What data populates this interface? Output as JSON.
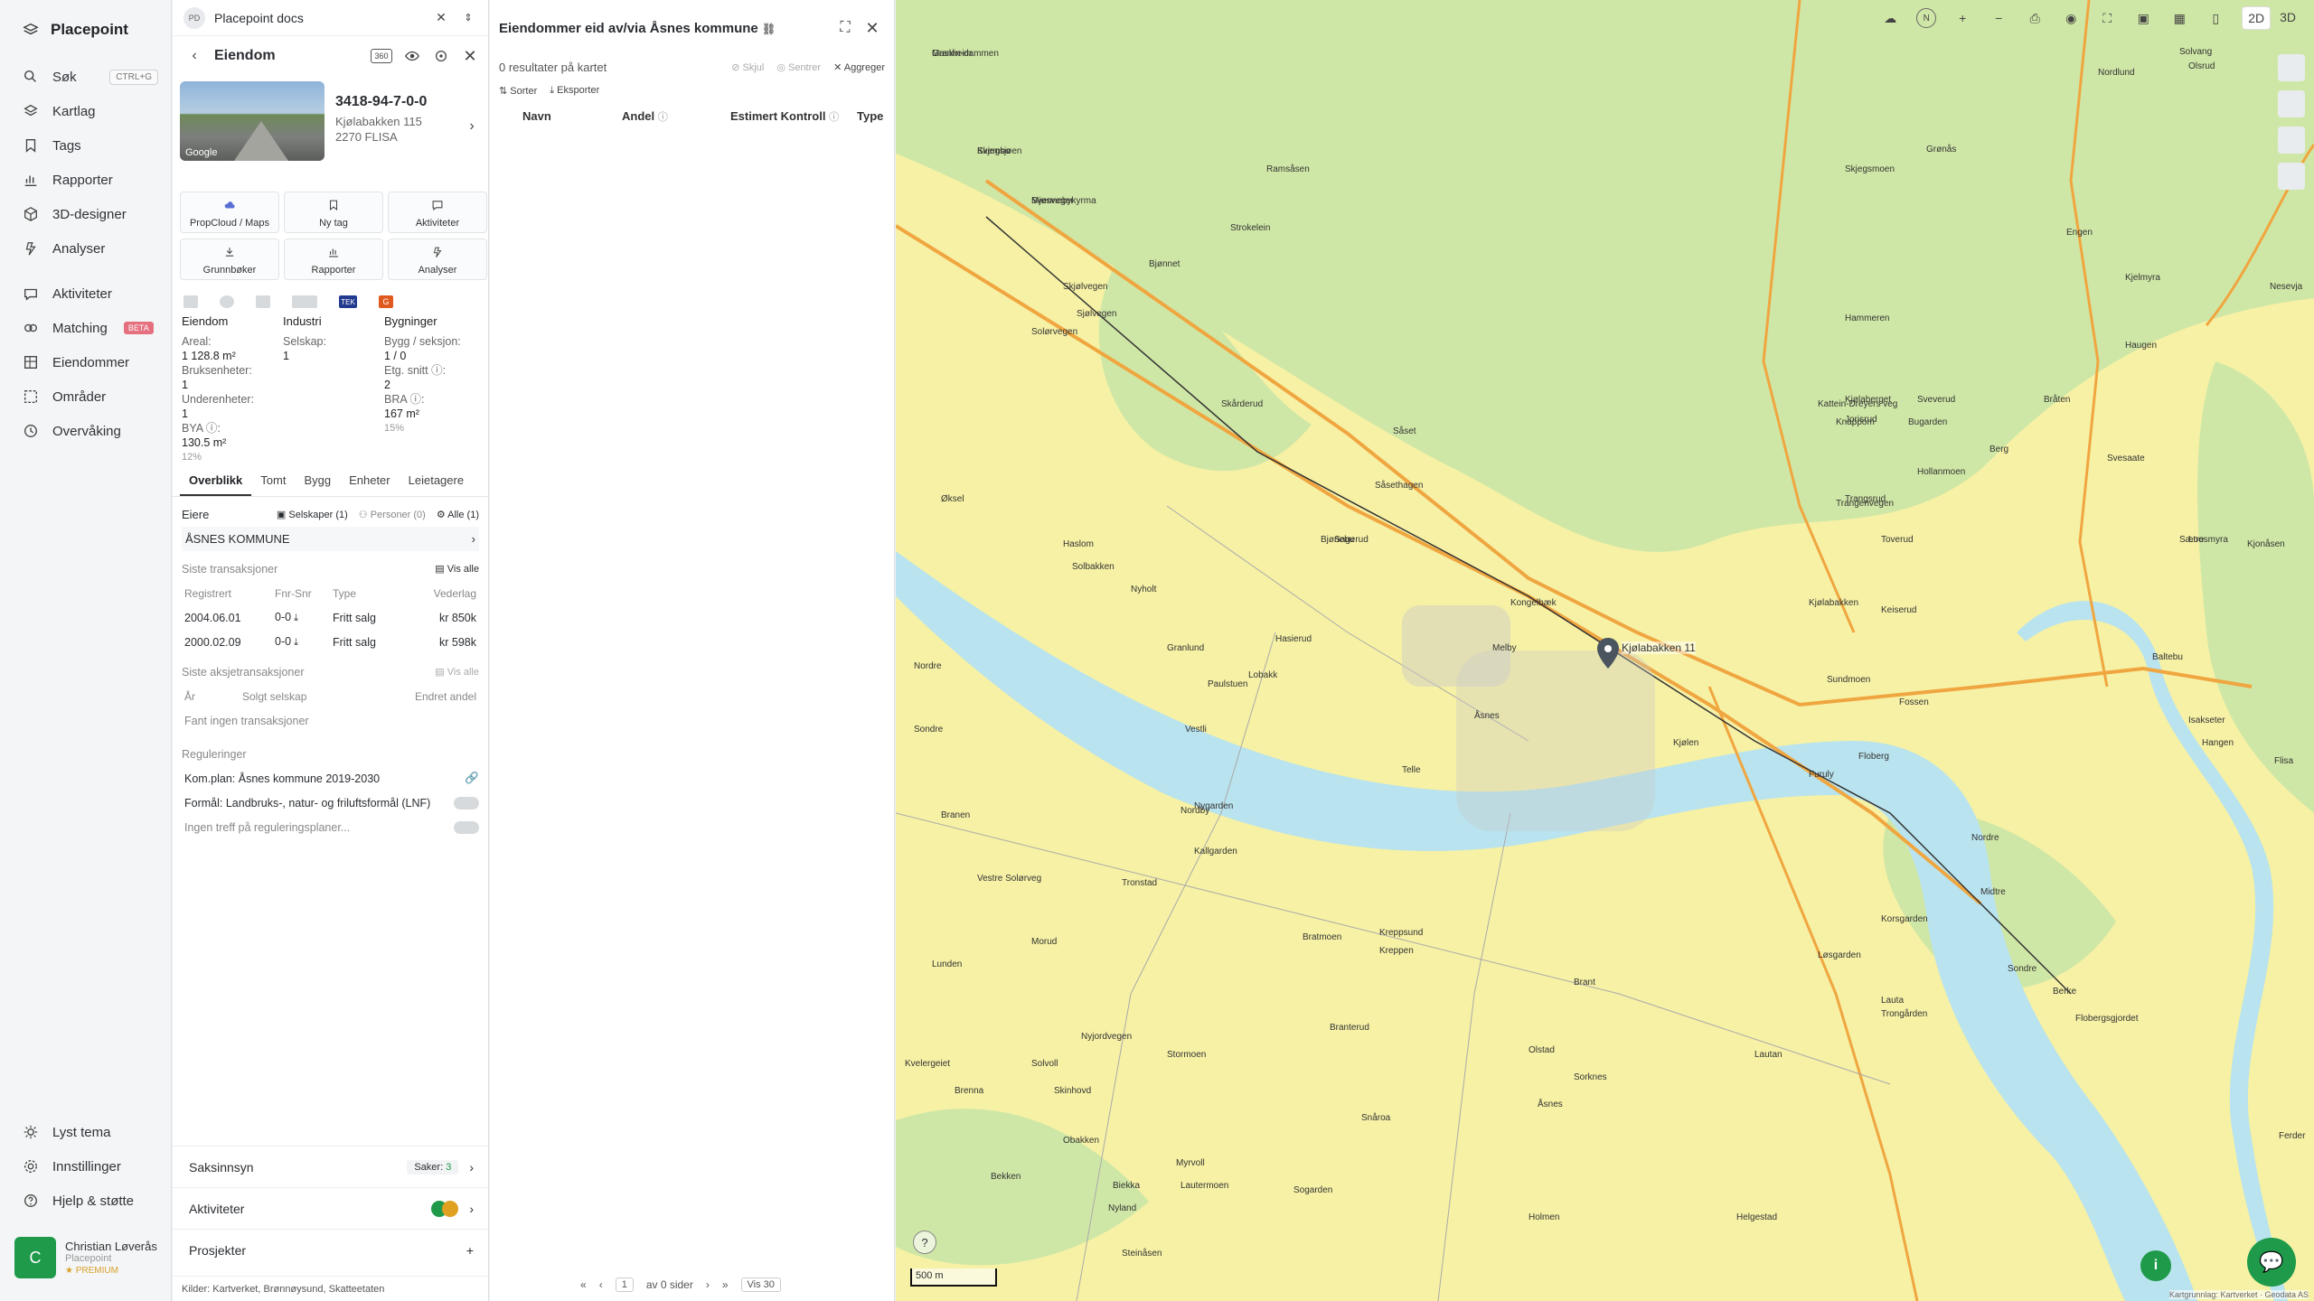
{
  "nav": {
    "brand": "Placepoint",
    "items": [
      {
        "label": "Søk",
        "icon": "search-icon",
        "shortcut": "CTRL+G"
      },
      {
        "label": "Kartlag",
        "icon": "layers-icon"
      },
      {
        "label": "Tags",
        "icon": "bookmark-icon"
      },
      {
        "label": "Rapporter",
        "icon": "chart-icon"
      },
      {
        "label": "3D-designer",
        "icon": "cube-icon"
      },
      {
        "label": "Analyser",
        "icon": "analyze-icon"
      },
      {
        "label": "Aktiviteter",
        "icon": "activity-icon"
      },
      {
        "label": "Matching",
        "icon": "matching-icon",
        "badge": "BETA"
      },
      {
        "label": "Eiendommer",
        "icon": "property-icon"
      },
      {
        "label": "Områder",
        "icon": "area-icon"
      },
      {
        "label": "Overvåking",
        "icon": "monitor-icon"
      }
    ],
    "bottom": [
      {
        "label": "Lyst tema",
        "icon": "sun-icon"
      },
      {
        "label": "Innstillinger",
        "icon": "settings-icon"
      },
      {
        "label": "Hjelp & støtte",
        "icon": "help-icon"
      }
    ],
    "user": {
      "initial": "C",
      "name": "Christian Løverås",
      "company": "Placepoint",
      "plan": "PREMIUM"
    }
  },
  "panel1": {
    "doc_label": "PD",
    "doc_title": "Placepoint docs",
    "header": "Eiendom",
    "property_id": "3418-94-7-0-0",
    "address_line1": "Kjølabakken 115",
    "address_line2": "2270 FLISA",
    "google_label": "Google",
    "actions": [
      {
        "label": "PropCloud / Maps",
        "icon": "cloud-icon"
      },
      {
        "label": "Ny tag",
        "icon": "bookmark-icon"
      },
      {
        "label": "Aktiviteter",
        "icon": "chat-icon"
      },
      {
        "label": "Grunnbøker",
        "icon": "download-icon"
      },
      {
        "label": "Rapporter",
        "icon": "chart-icon"
      },
      {
        "label": "Analyser",
        "icon": "analyze-icon"
      }
    ],
    "logos": {
      "tek": "TEK",
      "g": "G"
    },
    "facts": {
      "col1_head": "Eiendom",
      "col2_head": "Industri",
      "col3_head": "Bygninger",
      "areal_label": "Areal:",
      "areal_value": "1 128.8 m²",
      "selskap_label": "Selskap:",
      "selskap_value": "1",
      "bygg_label": "Bygg / seksjon:",
      "bygg_value": "1 / 0",
      "bruks_label": "Bruksenheter:",
      "bruks_value": "1",
      "etg_label": "Etg. snitt",
      "etg_value": "2",
      "under_label": "Underenheter:",
      "under_value": "1",
      "bra_label": "BRA",
      "bra_value": "167 m²",
      "bra_pct": "15%",
      "bya_label": "BYA",
      "bya_value": "130.5 m²",
      "bya_pct": "12%"
    },
    "tabs": [
      "Overblikk",
      "Tomt",
      "Bygg",
      "Enheter",
      "Leietagere"
    ],
    "owners": {
      "label": "Eiere",
      "selskaper": "Selskaper (1)",
      "personer": "Personer (0)",
      "alle": "Alle (1)",
      "owner_name": "ÅSNES KOMMUNE"
    },
    "transactions": {
      "title": "Siste transaksjoner",
      "vis_alle": "Vis alle",
      "headers": [
        "Registrert",
        "Fnr-Snr",
        "Type",
        "Vederlag"
      ],
      "rows": [
        [
          "2004.06.01",
          "0-0",
          "Fritt salg",
          "kr 850k"
        ],
        [
          "2000.02.09",
          "0-0",
          "Fritt salg",
          "kr 598k"
        ]
      ]
    },
    "share_tx": {
      "title": "Siste aksjetransaksjoner",
      "vis_alle": "Vis alle",
      "headers": [
        "År",
        "Solgt selskap",
        "Endret andel"
      ],
      "empty": "Fant ingen transaksjoner"
    },
    "regulations": {
      "title": "Reguleringer",
      "plan": "Kom.plan: Åsnes kommune 2019-2030",
      "purpose": "Formål: Landbruks-, natur- og friluftsformål (LNF)",
      "none": "Ingen treff på reguleringsplaner..."
    },
    "cards": {
      "saksinnsyn": "Saksinnsyn",
      "saker_label": "Saker:",
      "saker_count": "3",
      "aktiviteter": "Aktiviteter",
      "prosjekter": "Prosjekter"
    },
    "sources": "Kilder: Kartverket, Brønnøysund, Skatteetaten"
  },
  "panel2": {
    "title": "Eiendommer eid av/via Åsnes kommune",
    "results": "0 resultater på kartet",
    "skjul": "Skjul",
    "sentrer": "Sentrer",
    "aggreger": "Aggreger",
    "sorter": "Sorter",
    "eksporter": "Eksporter",
    "columns": [
      "Navn",
      "Andel",
      "Estimert Kontroll",
      "Type"
    ],
    "pager": {
      "page": "1",
      "of": "av 0 sider",
      "per": "Vis 30"
    }
  },
  "map": {
    "mode_2d": "2D",
    "mode_3d": "3D",
    "scale": "500 m",
    "pin_label": "Kjølabakken 11",
    "places": [
      "Granheim",
      "Kvembo",
      "Svennebykyrma",
      "Skjølvegen",
      "Bjønnet",
      "Ramsåsen",
      "Strokelein",
      "Solørvegen",
      "Sjølvegen",
      "Skårderud",
      "Såset",
      "Såsethagen",
      "Øksel",
      "Haslom",
      "Solbakken",
      "Nyholt",
      "Sagerud",
      "Bjønebu",
      "Kongelbæk",
      "Melby",
      "Granlund",
      "Hasierud",
      "Lobakk",
      "Paulstuen",
      "Vestli",
      "Nordre",
      "Sondre",
      "Åsnes",
      "Telle",
      "Nordby",
      "Nygarden",
      "Kallgarden",
      "Branen",
      "Vestre Solørveg",
      "Tronstad",
      "Bratmoen",
      "Kreppsund",
      "Kreppen",
      "Morud",
      "Lunden",
      "Kvelergeiet",
      "Brenna",
      "Solvoll",
      "Skinhovd",
      "Stormoen",
      "Nyjordvegen",
      "Obakken",
      "Bekken",
      "Biekka",
      "Myrvoll",
      "Nyland",
      "Lautermoen",
      "Steinåsen",
      "Branterud",
      "Snåroa",
      "Olstad",
      "Sorknes",
      "Åsnes",
      "Sogarden",
      "Holmen",
      "Helgestad",
      "Lautan",
      "Lauta",
      "Trongården",
      "Løsgarden",
      "Korsgarden",
      "Brant",
      "Kjølen",
      "Sundmoen",
      "Flobergsgjordet",
      "Kjølabakken",
      "Keiserud",
      "Toverud",
      "Berg",
      "Kattein-Dreyers veg",
      "Hollanmoen",
      "Sveverud",
      "Trangsrud",
      "Jorisrud",
      "Kjølaberget",
      "Grønås",
      "Skjegsmoen",
      "Kjelmyra",
      "Hammeren",
      "Haugen",
      "Trangenvegen",
      "Knappom",
      "Bråten",
      "Bugarden",
      "Svesaate",
      "Nordlund",
      "Solvang",
      "Olsrud",
      "Engen",
      "Fossen",
      "Isakseter",
      "Baltebu",
      "Flisa",
      "Hangen",
      "Furuly",
      "Floberg",
      "Nordre",
      "Midtre",
      "Sondre",
      "Berke",
      "Sætre",
      "Ferder",
      "Loosmyra",
      "Nesevja",
      "Kjonåsen",
      "Maskin-dammen",
      "Skjegsjøen",
      "Mjøsveger"
    ]
  },
  "colors": {
    "accent": "#1f9a4b",
    "beta": "#e5707f",
    "map_yellow": "#f6f1a5",
    "map_green": "#cfe7a6",
    "river": "#b9e3ee",
    "road": "#f0a640"
  }
}
